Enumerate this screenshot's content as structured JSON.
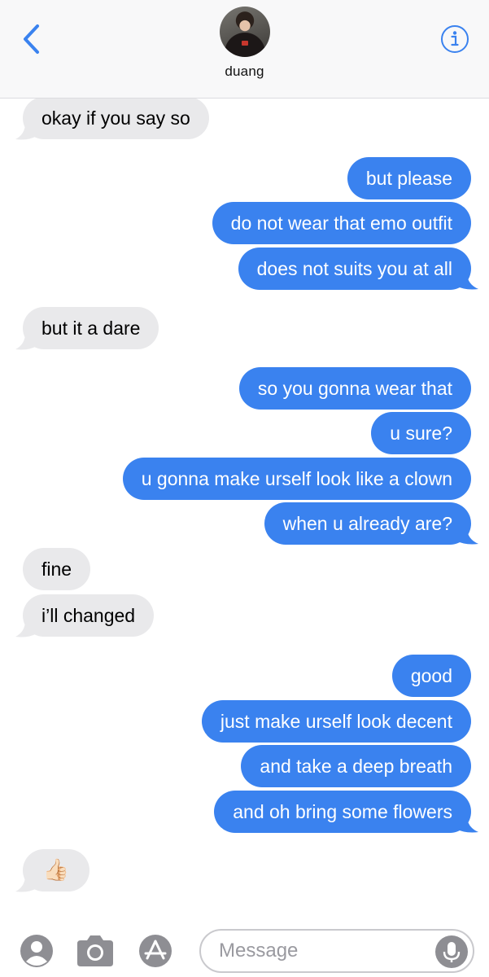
{
  "header": {
    "contact_name": "duang",
    "back_icon": "chevron-left-icon",
    "info_icon": "info-icon",
    "accent": "#3a82ef"
  },
  "colors": {
    "incoming_bubble": "#e9e9eb",
    "outgoing_bubble": "#3a82ef"
  },
  "messages": [
    {
      "from": "them",
      "text": "okay if you say so"
    },
    {
      "from": "me",
      "text": "but please"
    },
    {
      "from": "me",
      "text": "do not wear that emo outfit"
    },
    {
      "from": "me",
      "text": "does not suits you at all"
    },
    {
      "from": "them",
      "text": "but it a dare"
    },
    {
      "from": "me",
      "text": "so you gonna wear that"
    },
    {
      "from": "me",
      "text": "u sure?"
    },
    {
      "from": "me",
      "text": "u gonna make urself look like a clown"
    },
    {
      "from": "me",
      "text": "when u already are?"
    },
    {
      "from": "them",
      "text": "fine"
    },
    {
      "from": "them",
      "text": "i’ll changed"
    },
    {
      "from": "me",
      "text": "good"
    },
    {
      "from": "me",
      "text": "just make urself look decent"
    },
    {
      "from": "me",
      "text": "and take a deep breath"
    },
    {
      "from": "me",
      "text": "and oh bring some flowers"
    },
    {
      "from": "them",
      "text": "👍🏻",
      "emoji": "thumbs-up-icon"
    }
  ],
  "composer": {
    "placeholder": "Message",
    "icons": [
      "contact-icon",
      "camera-icon",
      "app-store-icon",
      "microphone-icon"
    ]
  }
}
